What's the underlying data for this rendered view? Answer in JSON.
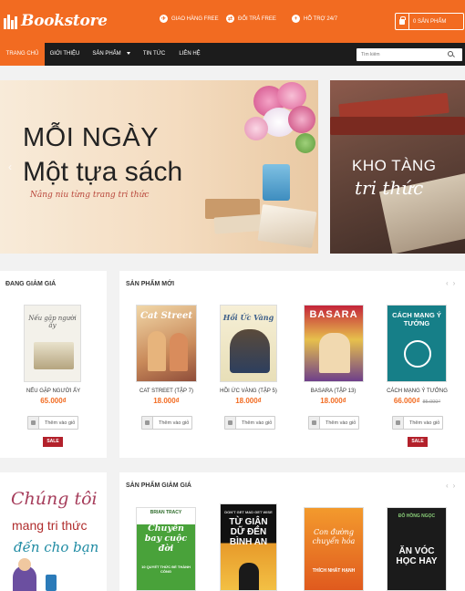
{
  "header": {
    "logo": "Bookstore",
    "perks": [
      {
        "icon": "plane-icon",
        "label": "GIAO HÀNG FREE"
      },
      {
        "icon": "exchange-icon",
        "label": "ĐỔI TRẢ FREE"
      },
      {
        "icon": "plus-icon",
        "label": "HỖ TRỢ 24/7"
      }
    ],
    "cart_label": "0 SẢN PHẨM"
  },
  "nav": {
    "items": [
      "TRANG CHỦ",
      "GIỚI THIỆU",
      "SẢN PHẨM",
      "TIN TỨC",
      "LIÊN HỆ"
    ],
    "search_placeholder": "Tìm kiếm"
  },
  "banner": {
    "line1": "MỖI NGÀY",
    "line2": "Một tựa sách",
    "line3": "Nâng niu từng trang tri thức",
    "side_line1": "KHO TÀNG",
    "side_line2": "tri thức"
  },
  "sale_section": {
    "title": "ĐANG GIẢM GIÁ",
    "product": {
      "name": "NẾU GẶP NGƯỜI ẤY",
      "price": "65.000₫",
      "old_price": "",
      "button": "Thêm vào giỏ",
      "badge": "SALE",
      "cover_title": "Nếu gặp người ấy"
    }
  },
  "new_section": {
    "title": "SẢN PHẨM MỚI",
    "products": [
      {
        "name": "CAT STREET (TẬP 7)",
        "price": "18.000₫",
        "old_price": "",
        "button": "Thêm vào giỏ",
        "badge": "",
        "cover_title": "Cat Street"
      },
      {
        "name": "HỒI ỨC VÀNG (TẬP 5)",
        "price": "18.000₫",
        "old_price": "",
        "button": "Thêm vào giỏ",
        "badge": "",
        "cover_title": "Hồi Ức Vàng"
      },
      {
        "name": "BASARA (TẬP 13)",
        "price": "18.000₫",
        "old_price": "",
        "button": "Thêm vào giỏ",
        "badge": "",
        "cover_title": "BASARA"
      },
      {
        "name": "CÁCH MẠNG Ý TƯỞNG",
        "price": "66.000₫",
        "old_price": "85.000₫",
        "button": "Thêm vào giỏ",
        "badge": "SALE",
        "cover_title": "CÁCH MẠNG Ý TƯỞNG"
      }
    ]
  },
  "promo": {
    "line1": "Chúng tôi",
    "line2": "mang tri thức",
    "line3": "đến cho bạn"
  },
  "discount_section": {
    "title": "SẢN PHẨM GIẢM GIÁ",
    "covers": [
      {
        "author": "BRIAN TRACY",
        "title": "Chuyến bay cuộc đời",
        "subtitle": "10 QUYẾT THỨC ĐỂ THÀNH CÔNG"
      },
      {
        "author": "DON'T GET MAD GET WISE",
        "title": "TỪ GIẬN DỮ ĐẾN BÌNH AN",
        "subtitle": ""
      },
      {
        "author": "",
        "title": "Con đường chuyển hóa",
        "subtitle": "THÍCH NHẤT HẠNH"
      },
      {
        "author": "ĐỖ HỒNG NGỌC",
        "title": "ĂN VÓC HỌC HAY",
        "subtitle": ""
      }
    ]
  },
  "colors": {
    "accent": "#f26b21",
    "nav": "#1c1c1c",
    "sale": "#b3212b"
  }
}
